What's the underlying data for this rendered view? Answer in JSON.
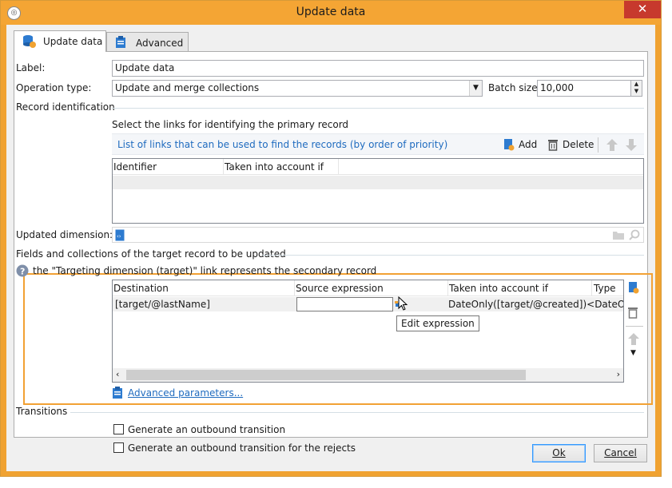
{
  "window": {
    "title": "Update data",
    "close_glyph": "✕"
  },
  "tabs": [
    {
      "label": "Update data",
      "icon": "database-update-icon"
    },
    {
      "label": "Advanced",
      "icon": "clipboard-icon"
    }
  ],
  "form": {
    "label_caption": "Label:",
    "label_value": "Update data",
    "operation_caption": "Operation type:",
    "operation_value": "Update and merge collections",
    "batch_caption": "Batch size:",
    "batch_value": "10,000"
  },
  "record_identification": {
    "section_title": "Record identification",
    "instruction": "Select the links for identifying the primary record",
    "list_caption": "List of links that can be used to find the records (by order of priority)",
    "add_label": "Add",
    "delete_label": "Delete",
    "columns": [
      "Identifier",
      "Taken into account if"
    ],
    "updated_dimension_caption": "Updated dimension:"
  },
  "fields_section": {
    "title": "Fields and collections of the target record to be updated",
    "info_text": "the \"Targeting dimension (target)\" link represents the secondary record",
    "columns": [
      "Destination",
      "Source expression",
      "Taken into account if",
      "Type"
    ],
    "rows": [
      {
        "destination": "[target/@lastName]",
        "source": "",
        "condition": "DateOnly([target/@created])<DateOnly(G"
      }
    ],
    "tooltip": "Edit expression",
    "advanced_link": "Advanced parameters..."
  },
  "transitions": {
    "section_title": "Transitions",
    "outbound_label": "Generate an outbound transition",
    "rejects_label": "Generate an outbound transition for the rejects"
  },
  "buttons": {
    "ok": "Ok",
    "cancel": "Cancel"
  },
  "colors": {
    "accent": "#f4a534",
    "highlight_border": "#f2a134",
    "link": "#1f6bbf"
  }
}
